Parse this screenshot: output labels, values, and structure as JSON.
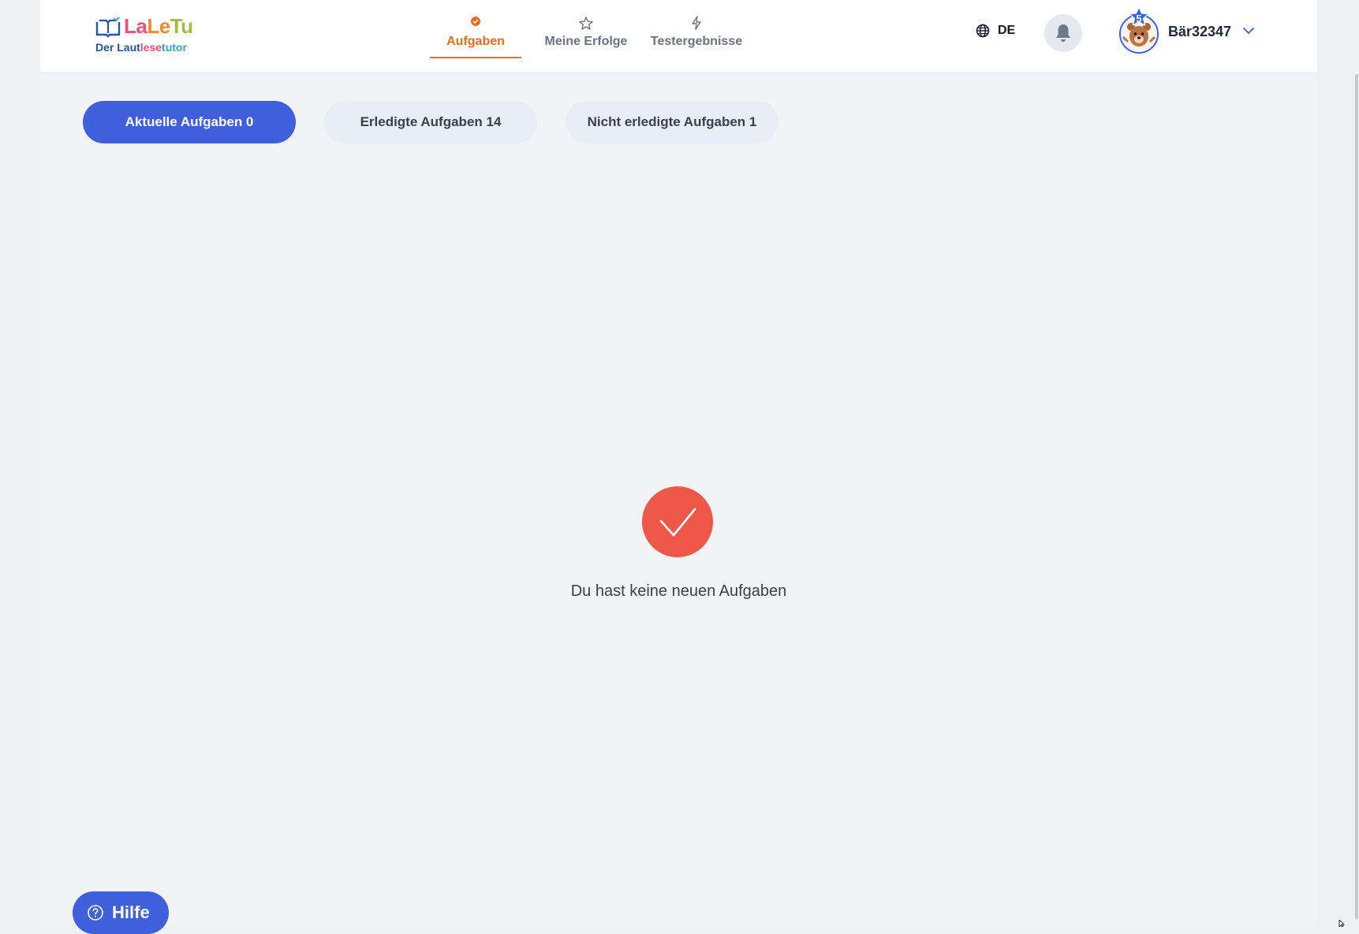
{
  "logo": {
    "brand_1": "La",
    "brand_2": "Le",
    "brand_3": "Tu",
    "sub_1": "Der ",
    "sub_2": "Laut",
    "sub_3": "lese",
    "sub_4": "tutor"
  },
  "nav": {
    "items": [
      {
        "label": "Aufgaben",
        "icon": "check-circle-icon",
        "active": true
      },
      {
        "label": "Meine Erfolge",
        "icon": "star-icon",
        "active": false
      },
      {
        "label": "Testergebnisse",
        "icon": "lightning-icon",
        "active": false
      }
    ]
  },
  "header": {
    "language": "DE",
    "username": "Bär32347",
    "level_badge": "5"
  },
  "tabs": [
    {
      "label": "Aktuelle Aufgaben 0",
      "active": true
    },
    {
      "label": "Erledigte Aufgaben 14",
      "active": false
    },
    {
      "label": "Nicht erledigte Aufgaben 1",
      "active": false
    }
  ],
  "empty_state": {
    "message": "Du hast keine neuen Aufgaben"
  },
  "help": {
    "label": "Hilfe"
  },
  "colors": {
    "accent_blue": "#3f5fdd",
    "accent_orange": "#ef6c1f",
    "empty_red": "#ef5748"
  }
}
